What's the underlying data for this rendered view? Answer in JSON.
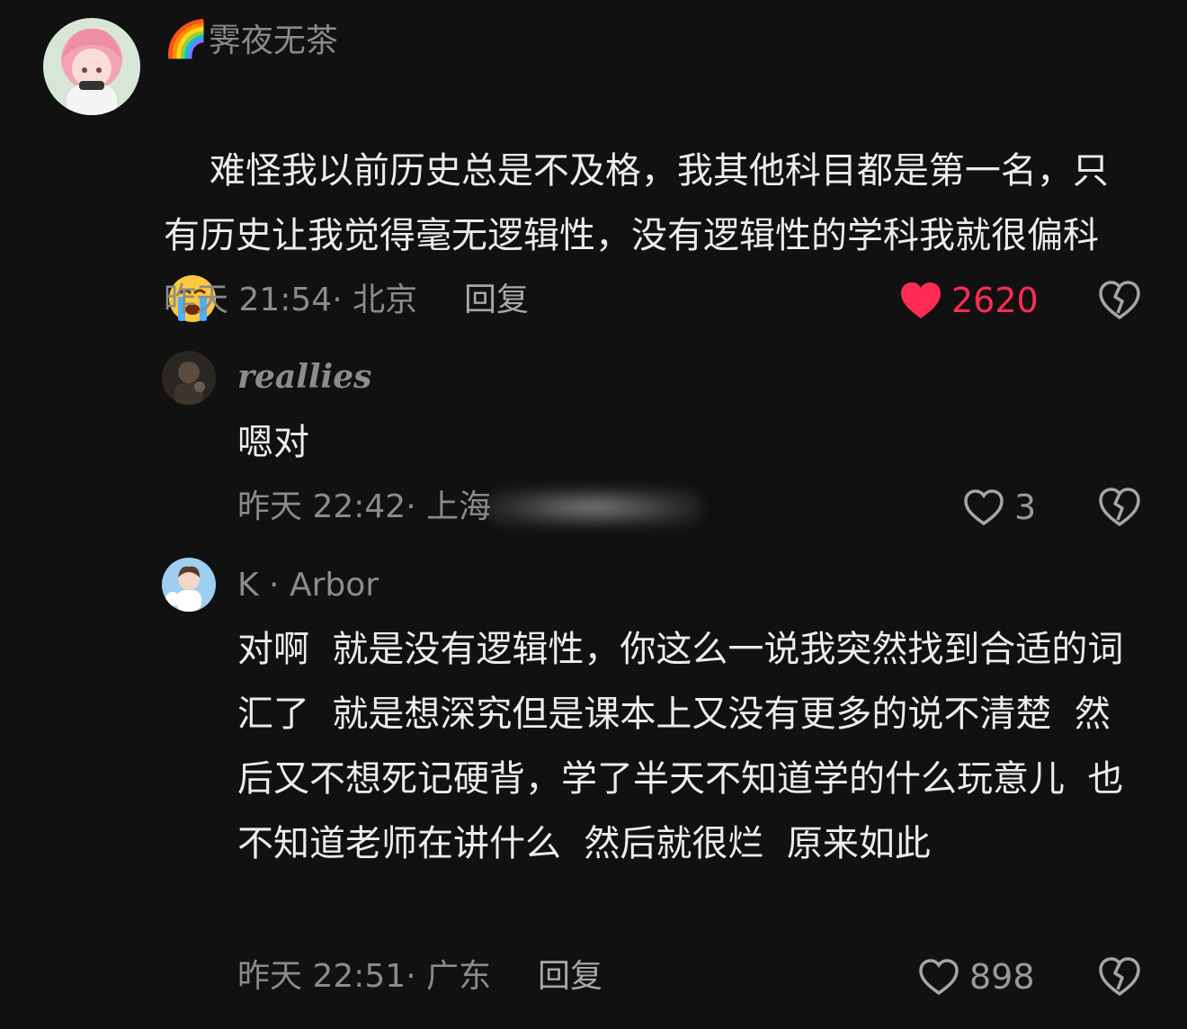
{
  "comments": [
    {
      "username_prefix": "🌈",
      "username": "霁夜无茶",
      "content": "难怪我以前历史总是不及格，我其他科目都是第一名，只有历史让我觉得毫无逻辑性，没有逻辑性的学科我就很偏科",
      "emoji": "loudly-crying-face",
      "time": "昨天 21:54",
      "location": "北京",
      "reply_label": "回复",
      "likes": "2620",
      "liked": true
    },
    {
      "username": "reallies",
      "content": "嗯对",
      "time": "昨天 22:42",
      "location": "上海",
      "likes": "3",
      "liked": false
    },
    {
      "username": "K · Arbor",
      "content": "对啊  就是没有逻辑性，你这么一说我突然找到合适的词汇了  就是想深究但是课本上又没有更多的说不清楚  然后又不想死记硬背，学了半天不知道学的什么玩意儿  也不知道老师在讲什么  然后就很烂  原来如此",
      "time": "昨天 22:51",
      "location": "广东",
      "reply_label": "回复",
      "likes": "898",
      "liked": false
    }
  ],
  "colors": {
    "background": "#111111",
    "like_active": "#fe2c55",
    "meta_text": "#8b8b8b"
  }
}
